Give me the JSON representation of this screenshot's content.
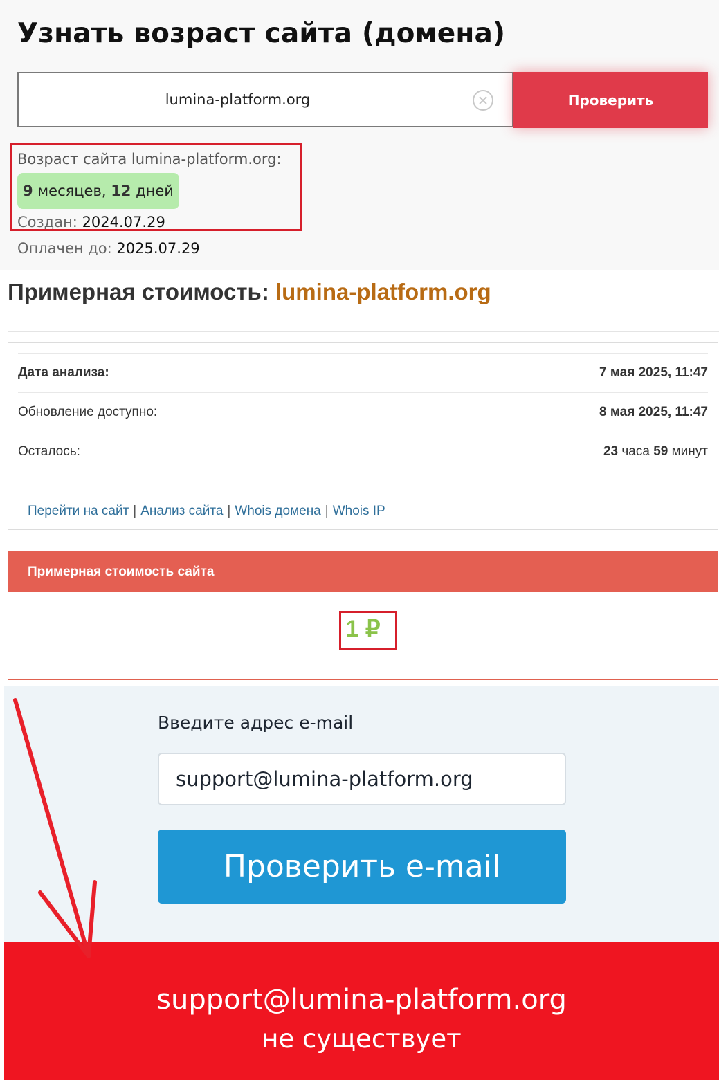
{
  "age_check": {
    "title": "Узнать возраст сайта (домена)",
    "domain_input_value": "lumina-platform.org",
    "check_button_label": "Проверить",
    "age_label": "Возраст сайта lumina-platform.org:",
    "age_months_num": "9",
    "age_months_word": " месяцев, ",
    "age_days_num": "12",
    "age_days_word": " дней",
    "created_label": "Создан:",
    "created_value": "2024.07.29",
    "paid_label": "Оплачен до:",
    "paid_value": "2025.07.29"
  },
  "cost": {
    "heading_prefix": "Примерная стоимость:",
    "heading_domain": "lumina-platform.org",
    "rows": [
      {
        "label": "Дата анализа:",
        "value": "7 мая 2025, 11:47"
      },
      {
        "label": "Обновление доступно:",
        "value": "8 мая 2025, 11:47"
      },
      {
        "label": "Осталось:",
        "hours_num": "23",
        "hours_word": " часа ",
        "minutes_num": "59",
        "minutes_word": " минут"
      }
    ],
    "links": [
      "Перейти на сайт",
      "Анализ сайта",
      "Whois домена",
      "Whois IP"
    ],
    "link_separator": "|",
    "price_header": "Примерная стоимость сайта",
    "price_value": "1 ₽"
  },
  "email_check": {
    "label": "Введите адрес e-mail",
    "input_value": "support@lumina-platform.org",
    "button_label": "Проверить e-mail",
    "result_email": "support@lumina-platform.org",
    "result_status": "не существует"
  },
  "colors": {
    "check_button": "#e03a4a",
    "age_badge": "#b6ebac",
    "cost_domain": "#b86b14",
    "price_header": "#e45f52",
    "price_value": "#8bc34a",
    "email_button": "#1f97d4",
    "result_banner": "#ef1521",
    "annotation": "#e8202a"
  },
  "icons": {
    "clear": "close-circle-icon",
    "annotation": "red-arrow-down"
  }
}
